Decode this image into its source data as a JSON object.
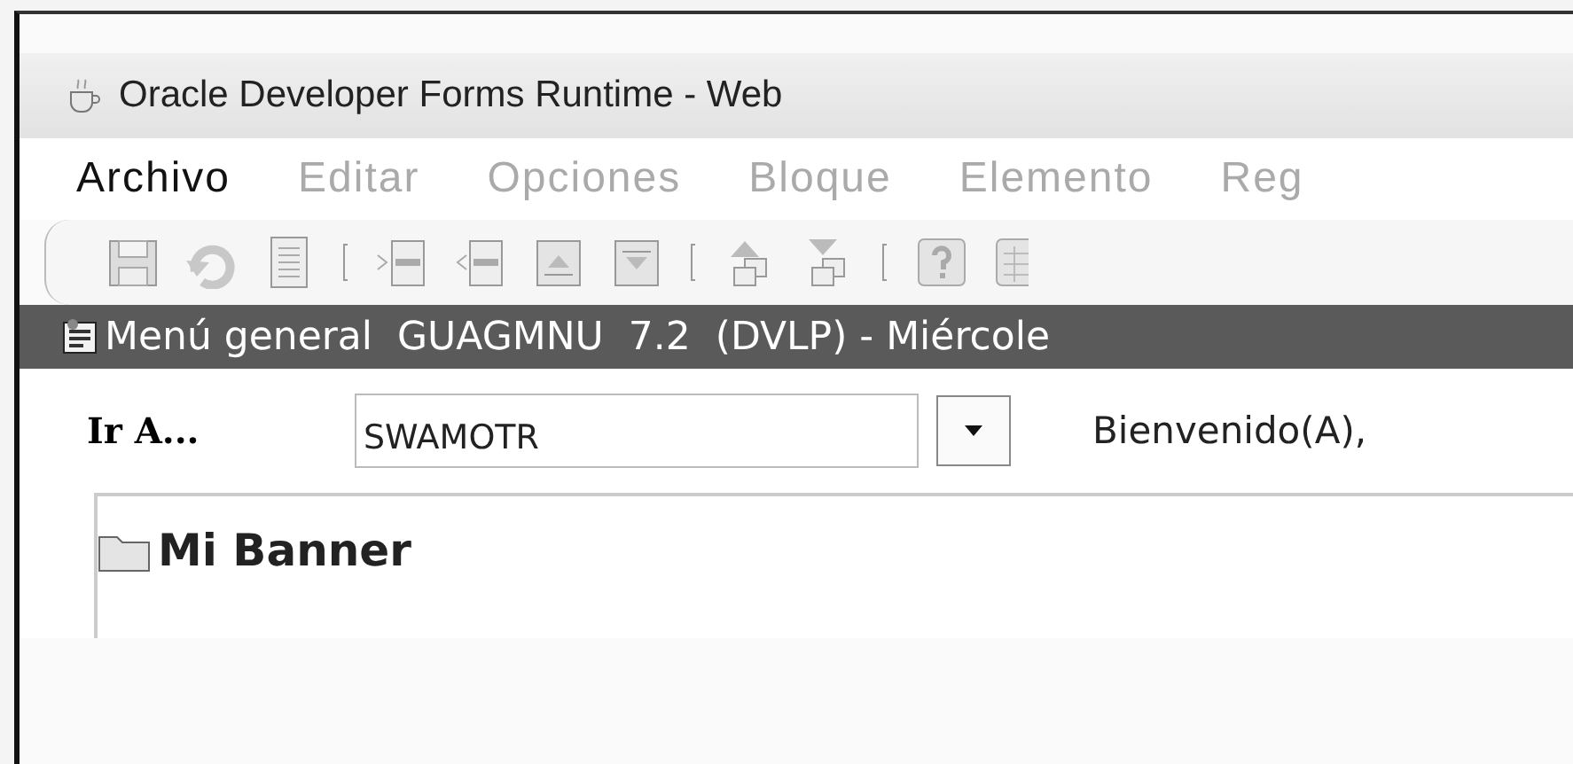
{
  "window": {
    "title": "Oracle Developer Forms Runtime - Web"
  },
  "menu": [
    {
      "label": "Archivo",
      "disabled": false
    },
    {
      "label": "Editar",
      "disabled": true
    },
    {
      "label": "Opciones",
      "disabled": true
    },
    {
      "label": "Bloque",
      "disabled": true
    },
    {
      "label": "Elemento",
      "disabled": true
    },
    {
      "label": "Reg",
      "disabled": true
    }
  ],
  "toolbar": [
    {
      "kind": "save"
    },
    {
      "kind": "undo"
    },
    {
      "kind": "doc"
    },
    {
      "kind": "sep"
    },
    {
      "kind": "next-doc"
    },
    {
      "kind": "prev-doc"
    },
    {
      "kind": "up-doc"
    },
    {
      "kind": "down-doc"
    },
    {
      "kind": "sep"
    },
    {
      "kind": "up-record"
    },
    {
      "kind": "down-record"
    },
    {
      "kind": "sep"
    },
    {
      "kind": "help"
    },
    {
      "kind": "grid"
    }
  ],
  "inner_window": {
    "title": "Menú general  GUAGMNU  7.2  (DVLP) - Miércole"
  },
  "goto": {
    "label": "Ir A...",
    "value": "SWAMOTR"
  },
  "welcome": "Bienvenido(A),",
  "banner": {
    "label": "Mi Banner"
  }
}
